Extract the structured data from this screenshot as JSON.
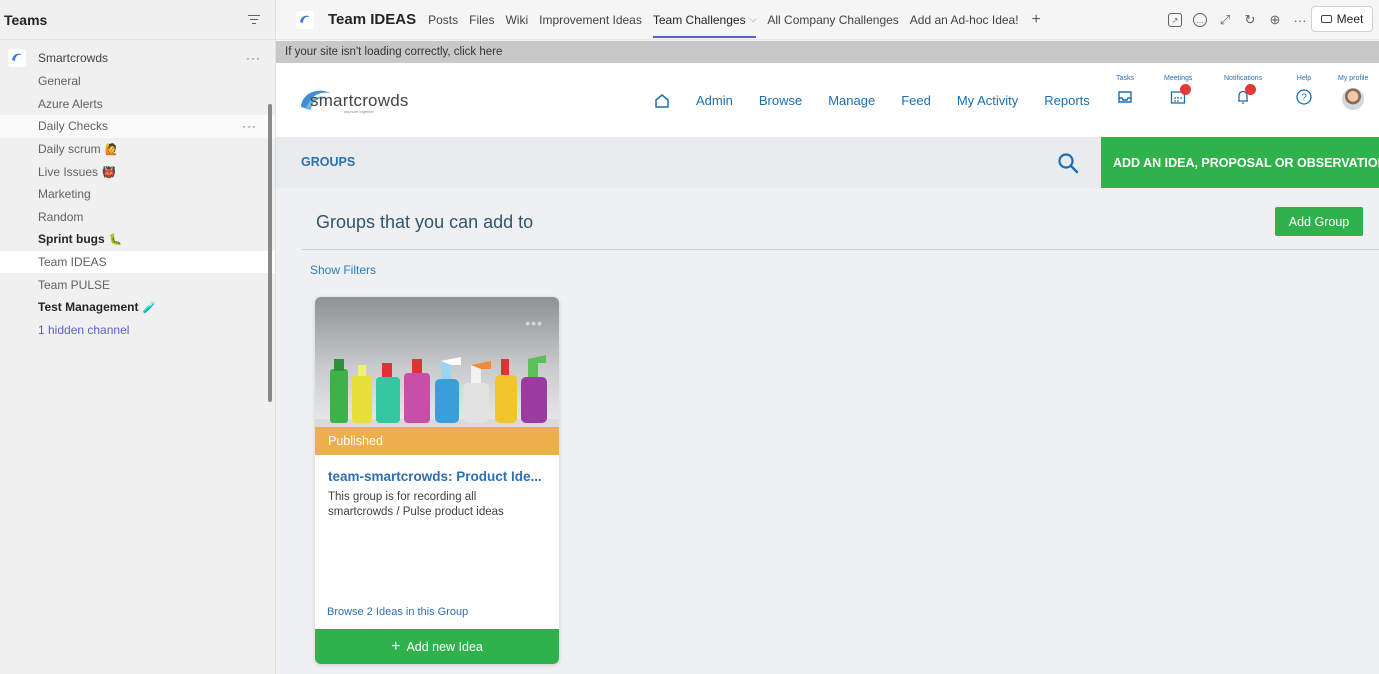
{
  "teams": {
    "title": "Teams",
    "team_name": "Smartcrowds",
    "channels": [
      {
        "label": "General",
        "emoji": ""
      },
      {
        "label": "Azure Alerts",
        "emoji": ""
      },
      {
        "label": "Daily Checks",
        "emoji": ""
      },
      {
        "label": "Daily scrum",
        "emoji": "🙋"
      },
      {
        "label": "Live Issues",
        "emoji": "👹"
      },
      {
        "label": "Marketing",
        "emoji": ""
      },
      {
        "label": "Random",
        "emoji": ""
      },
      {
        "label": "Sprint bugs",
        "emoji": "🐛"
      },
      {
        "label": "Team IDEAS",
        "emoji": ""
      },
      {
        "label": "Team PULSE",
        "emoji": ""
      },
      {
        "label": "Test Management",
        "emoji": "🧪"
      },
      {
        "label": "1 hidden channel",
        "emoji": ""
      }
    ],
    "more": "···"
  },
  "tabbar": {
    "title": "Team IDEAS",
    "tabs": [
      "Posts",
      "Files",
      "Wiki",
      "Improvement Ideas",
      "Team Challenges",
      "All Company Challenges",
      "Add an Ad-hoc Idea!"
    ],
    "more": "···",
    "meet_label": "Meet"
  },
  "notice": "If your site isn't loading correctly, click here",
  "smartcrowds": {
    "logo_text": "smartcrowds",
    "logo_sub": "improve together",
    "nav": [
      "Admin",
      "Browse",
      "Manage",
      "Feed",
      "My Activity",
      "Reports"
    ],
    "utils": [
      "Tasks",
      "Meetings",
      "Notifications",
      "Help",
      "My profile"
    ],
    "groups_label": "GROUPS",
    "add_idea_label": "ADD AN IDEA, PROPOSAL OR OBSERVATION"
  },
  "main": {
    "section_title": "Groups that you can add to",
    "add_group_label": "Add Group",
    "show_filters": "Show Filters",
    "card": {
      "dots": "•••",
      "status": "Published",
      "title": "team-smartcrowds: Product Ide...",
      "description": "This group is for recording all smartcrowds / Pulse  product ideas",
      "browse": "Browse 2 Ideas in this Group",
      "add_label": "Add new Idea",
      "plus": "+"
    }
  },
  "colors": {
    "green": "#2fb24c",
    "link_blue": "#2d6fb0",
    "status_orange": "#efae4c",
    "teams_purple": "#5b5fc7",
    "badge_red": "#e53935"
  }
}
